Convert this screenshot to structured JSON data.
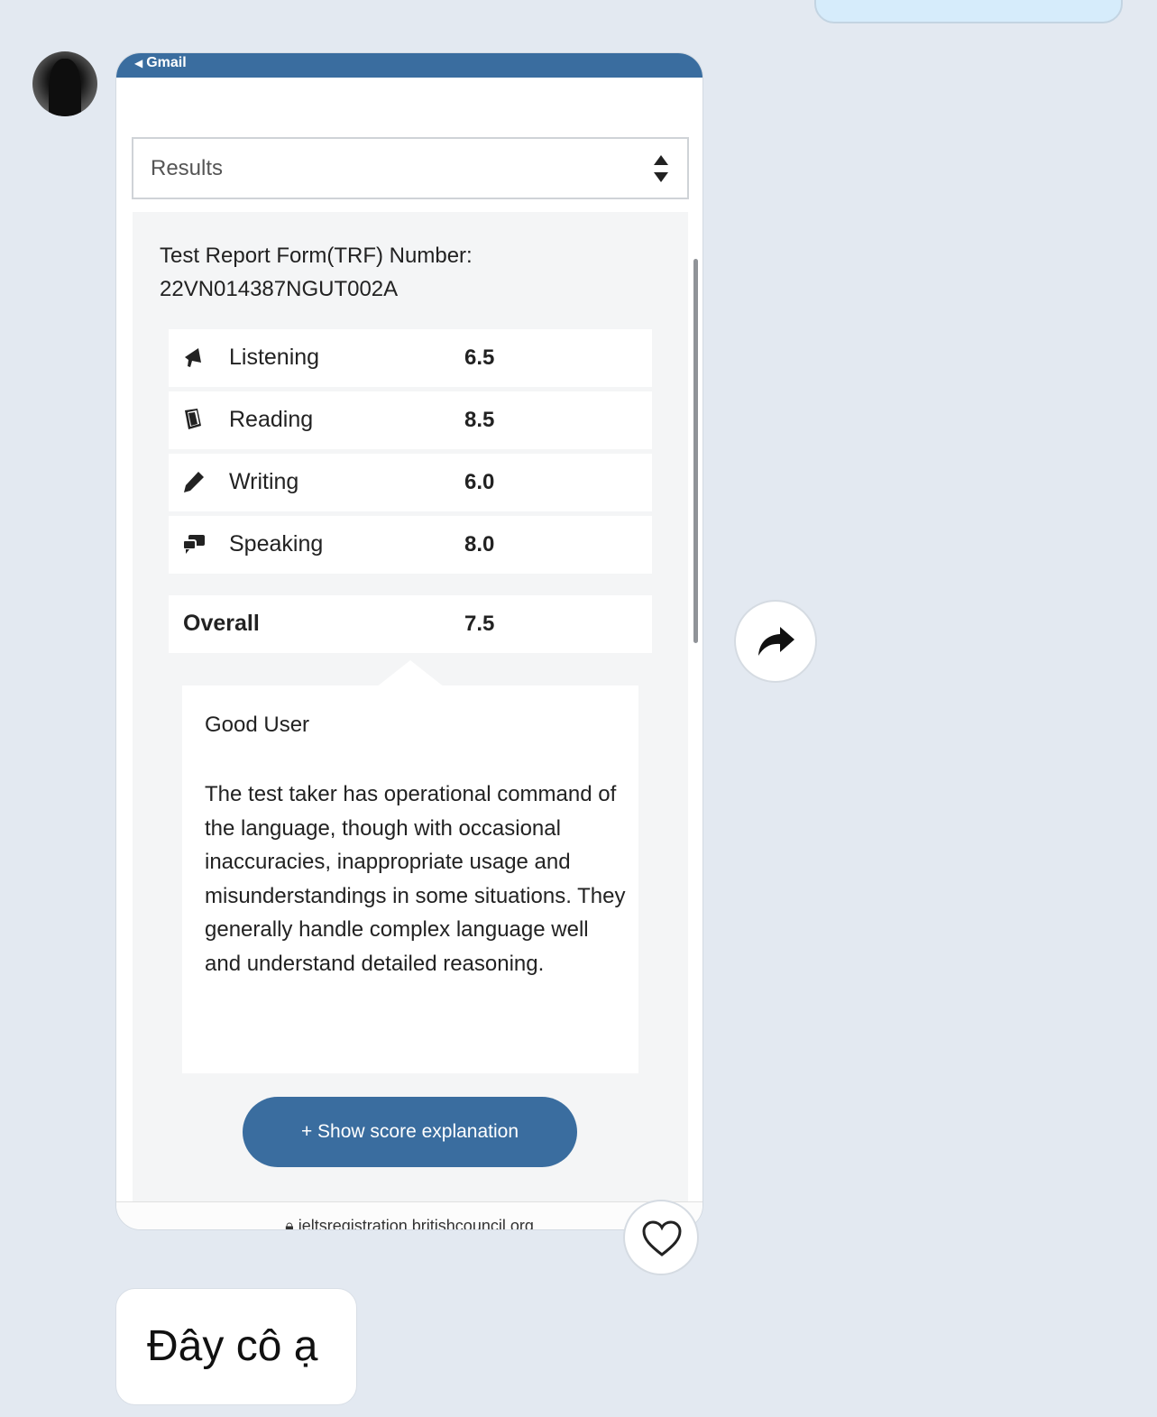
{
  "top_bubble": {},
  "avatar": {
    "alt": "sender avatar"
  },
  "screenshot": {
    "status_bar": {
      "back_label": "Gmail"
    },
    "select": {
      "value": "Results"
    },
    "trf": {
      "label": "Test Report Form(TRF) Number:",
      "number": "22VN014387NGUT002A"
    },
    "scores": [
      {
        "icon": "megaphone-icon",
        "label": "Listening",
        "value": "6.5"
      },
      {
        "icon": "book-icon",
        "label": "Reading",
        "value": "8.5"
      },
      {
        "icon": "pencil-icon",
        "label": "Writing",
        "value": "6.0"
      },
      {
        "icon": "chat-icon",
        "label": "Speaking",
        "value": "8.0"
      }
    ],
    "overall": {
      "label": "Overall",
      "value": "7.5"
    },
    "description": {
      "title": "Good User",
      "text": "The test taker has operational command of the language, though with occasional inaccuracies, inappropriate usage and misunderstandings in some situations. They generally handle complex language well and understand detailed reasoning."
    },
    "show_button": "+ Show score explanation",
    "url": "ieltsregistration.britishcouncil.org"
  },
  "message": {
    "text": "Đây cô ạ"
  },
  "colors": {
    "accent": "#3a6d9f",
    "background": "#e3e9f1",
    "panel": "#f4f5f6"
  }
}
